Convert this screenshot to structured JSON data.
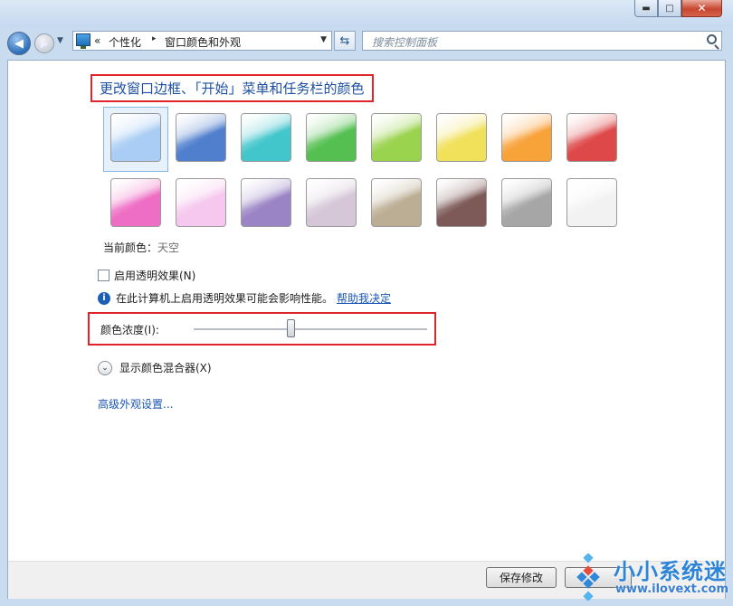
{
  "titlebar": {
    "minimize": "▬",
    "maximize": "□",
    "close": "✕"
  },
  "nav": {
    "back_glyph": "◀",
    "forward_glyph": "▶",
    "history_glyph": "▼",
    "address": {
      "overflow": "«",
      "crumbs": [
        "个性化",
        "窗口颜色和外观"
      ],
      "separator": "▸",
      "dropdown": "▼"
    },
    "refresh_glyph": "⇆",
    "search_placeholder": "搜索控制面板"
  },
  "main": {
    "title": "更改窗口边框、「开始」菜单和任务栏的颜色",
    "swatches": [
      {
        "name": "sky",
        "color": "#a9cdf5",
        "selected": true
      },
      {
        "name": "twilight",
        "color": "#4f7fcd"
      },
      {
        "name": "sea",
        "color": "#42c6cc"
      },
      {
        "name": "leaf",
        "color": "#55c051"
      },
      {
        "name": "lime",
        "color": "#9ad34e"
      },
      {
        "name": "sun",
        "color": "#f1e05a"
      },
      {
        "name": "pumpkin",
        "color": "#f8a23a"
      },
      {
        "name": "blush",
        "color": "#de4848"
      },
      {
        "name": "fuchsia",
        "color": "#ef6ec5"
      },
      {
        "name": "violet",
        "color": "#f6c7ef"
      },
      {
        "name": "lavender",
        "color": "#9b84c6"
      },
      {
        "name": "taupe",
        "color": "#d5c7d8"
      },
      {
        "name": "chocolate",
        "color": "#bcae94"
      },
      {
        "name": "slate",
        "color": "#7d5a58"
      },
      {
        "name": "frost",
        "color": "#a6a6a6"
      },
      {
        "name": "white",
        "color": "#f2f2f2"
      }
    ],
    "current_color_label": "当前颜色：",
    "current_color_value": "天空",
    "transparency_label": "启用透明效果(N)",
    "transparency_checked": false,
    "info_icon": "i",
    "info_text": "在此计算机上启用透明效果可能会影响性能。",
    "help_link": "帮助我决定",
    "intensity_label": "颜色浓度(I):",
    "intensity_level": 0.42,
    "mixer_glyph": "⌄",
    "mixer_label": "显示颜色混合器(X)",
    "advanced_link": "高级外观设置..."
  },
  "footer": {
    "save_label": "保存修改",
    "cancel_label": ""
  },
  "watermark": {
    "title": "小小系统迷",
    "url": "www.ilovext.com"
  },
  "colors": {
    "highlight_border": "#e0242b",
    "title_text": "#1c4fa0",
    "link": "#1a56b6"
  }
}
